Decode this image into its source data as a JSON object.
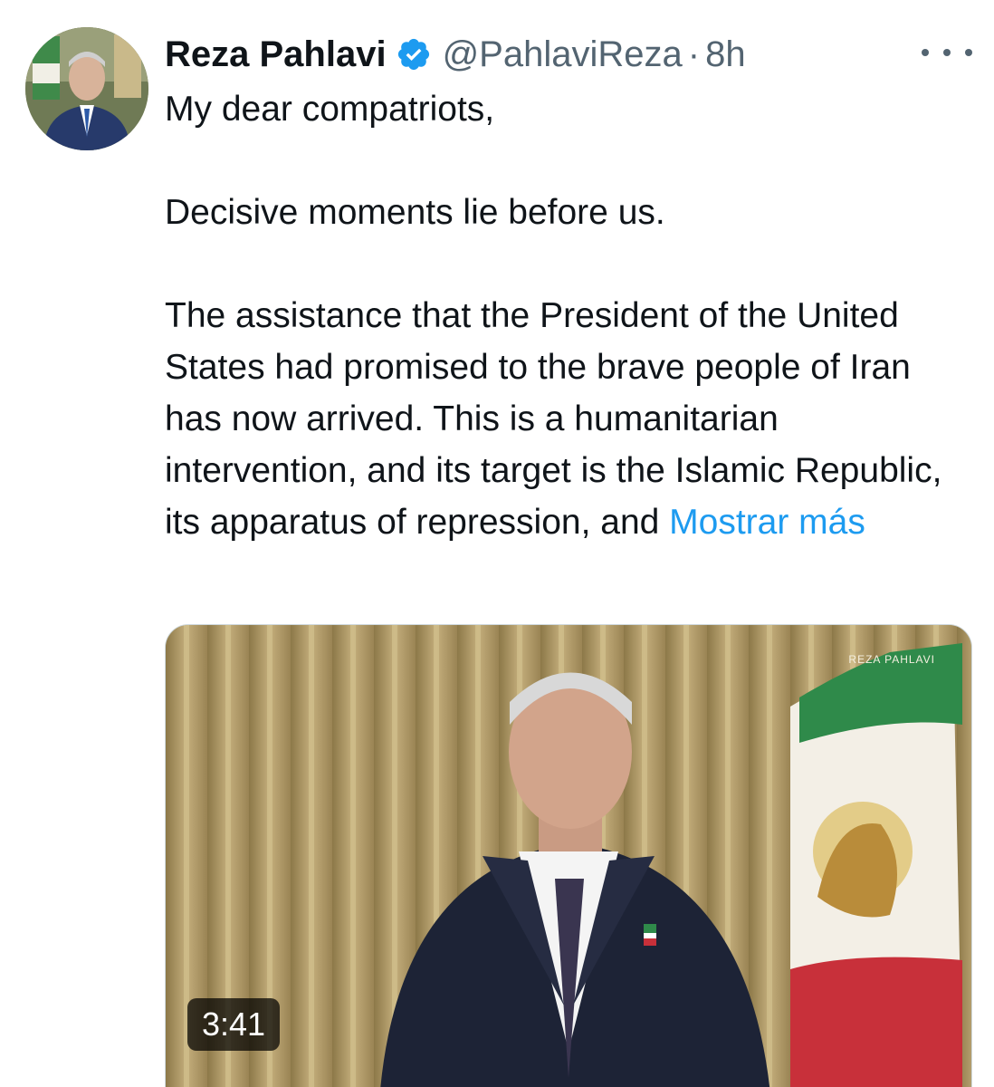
{
  "tweet": {
    "author_name": "Reza Pahlavi",
    "handle": "@PahlaviReza",
    "separator": "·",
    "time": "8h",
    "paragraphs": [
      "My dear compatriots,",
      "Decisive moments lie before us.",
      "The assistance that the President of the United States had promised to the brave people of Iran has now arrived. This is a humanitarian intervention, and its target is the Islamic Republic, its apparatus of repression, and"
    ],
    "show_more": "Mostrar más"
  },
  "video": {
    "duration": "3:41",
    "watermark_text": "REZA PAHLAVI"
  },
  "icons": {
    "verified": "verified-badge-icon",
    "more": "more-options-icon"
  },
  "colors": {
    "link": "#1d9bf0",
    "secondary_text": "#536471",
    "primary_text": "#0f1419",
    "verified": "#1d9bf0"
  }
}
